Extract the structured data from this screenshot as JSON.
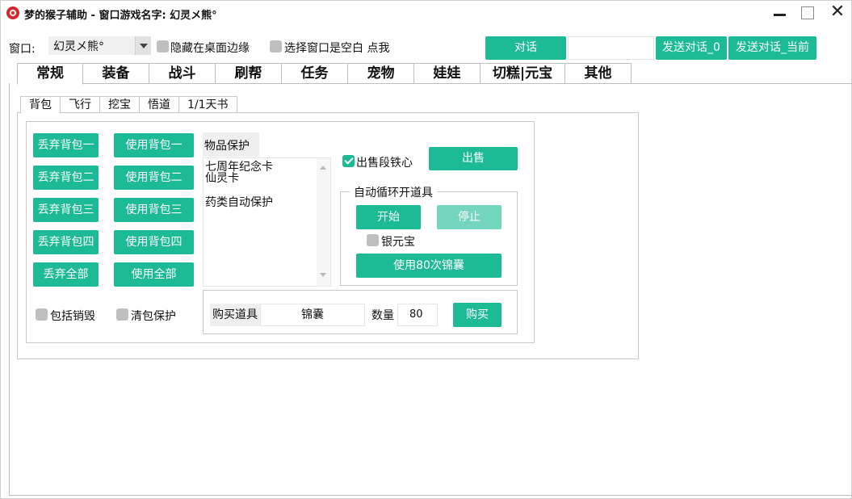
{
  "titlebar": {
    "title": "梦的猴子辅助 - 窗口游戏名字: 幻灵メ熊°"
  },
  "toolbar": {
    "window_label": "窗口:",
    "window_select_value": "幻灵メ熊°",
    "hide_edge_label": "隐藏在桌面边缘",
    "select_blank_label": "选择窗口是空白 点我",
    "chat_button": "对话",
    "chat_input_value": "",
    "send_chat_0": "发送对话_0",
    "send_chat_current": "发送对话_当前"
  },
  "main_tabs": [
    "常规",
    "装备",
    "战斗",
    "刷帮",
    "任务",
    "宠物",
    "娃娃",
    "切糕|元宝",
    "其他"
  ],
  "sub_tabs": [
    "背包",
    "飞行",
    "挖宝",
    "悟道",
    "1/1天书"
  ],
  "bag": {
    "discard": [
      "丢弃背包一",
      "丢弃背包二",
      "丢弃背包三",
      "丢弃背包四",
      "丢弃全部"
    ],
    "use": [
      "使用背包一",
      "使用背包二",
      "使用背包三",
      "使用背包四",
      "使用全部"
    ],
    "include_destroy_label": "包括销毁",
    "clear_protect_label": "清包保护"
  },
  "item_protect": {
    "title": "物品保护",
    "items": [
      "七周年纪念卡",
      "仙灵卡",
      "",
      "药类自动保护"
    ]
  },
  "sell": {
    "checkbox_label": "出售段铁心",
    "sell_button": "出售"
  },
  "auto_cycle": {
    "group_title": "自动循环开道具",
    "start_button": "开始",
    "stop_button": "停止",
    "silver_label": "银元宝",
    "use80_button": "使用80次锦囊"
  },
  "buy": {
    "label": "购买道具",
    "item_value": "锦囊",
    "qty_label": "数量",
    "qty_value": "80",
    "buy_button": "购买"
  },
  "colors": {
    "accent": "#1dba96",
    "accent_disabled": "#74d6be",
    "close_red": "#d9272e"
  }
}
